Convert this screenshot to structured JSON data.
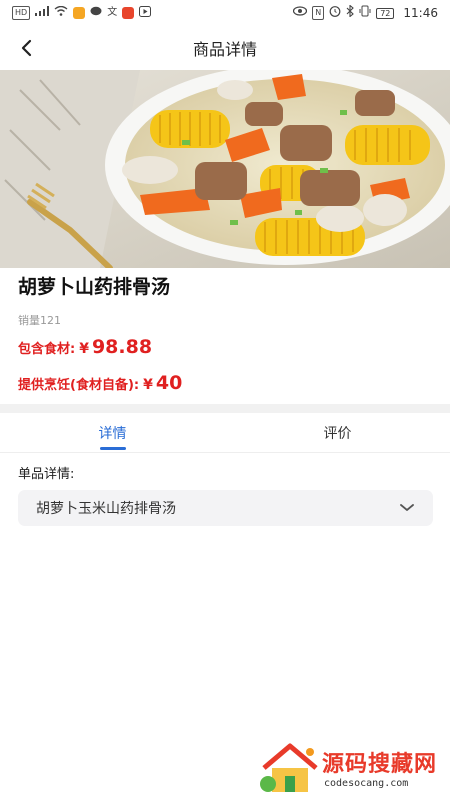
{
  "status_bar": {
    "left_icons": [
      "hd-icon",
      "signal-icon",
      "wifi-icon",
      "app-icon",
      "chat-icon",
      "translate-icon",
      "send-icon",
      "video-icon"
    ],
    "right_icons": [
      "eye-icon",
      "nfc-icon",
      "alarm-icon",
      "bluetooth-icon",
      "vibrate-icon"
    ],
    "battery": "72",
    "time": "11:46"
  },
  "header": {
    "title": "商品详情"
  },
  "product": {
    "name": "胡萝卜山药排骨汤",
    "sales_label": "销量",
    "sales_value": "121",
    "price_label": "包含食材:",
    "currency": "¥",
    "price_value": "98.88",
    "cook_label": "提供烹饪(食材自备):",
    "cook_value": "40"
  },
  "tabs": [
    {
      "label": "详情",
      "active": true
    },
    {
      "label": "评价",
      "active": false
    }
  ],
  "detail": {
    "section_label": "单品详情:",
    "selected_value": "胡萝卜玉米山药排骨汤"
  },
  "watermark": {
    "text": "源码搜藏网",
    "url": "codesocang.com"
  },
  "colors": {
    "price_red": "#e02020",
    "tab_active": "#2a6dd6",
    "watermark_red": "#e83a2a"
  }
}
